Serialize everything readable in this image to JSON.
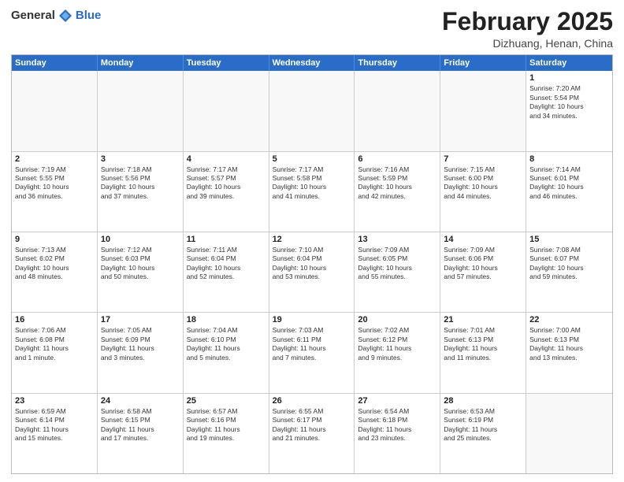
{
  "header": {
    "logo_general": "General",
    "logo_blue": "Blue",
    "month_title": "February 2025",
    "location": "Dizhuang, Henan, China"
  },
  "weekdays": [
    "Sunday",
    "Monday",
    "Tuesday",
    "Wednesday",
    "Thursday",
    "Friday",
    "Saturday"
  ],
  "rows": [
    [
      {
        "day": "",
        "info": ""
      },
      {
        "day": "",
        "info": ""
      },
      {
        "day": "",
        "info": ""
      },
      {
        "day": "",
        "info": ""
      },
      {
        "day": "",
        "info": ""
      },
      {
        "day": "",
        "info": ""
      },
      {
        "day": "1",
        "info": "Sunrise: 7:20 AM\nSunset: 5:54 PM\nDaylight: 10 hours\nand 34 minutes."
      }
    ],
    [
      {
        "day": "2",
        "info": "Sunrise: 7:19 AM\nSunset: 5:55 PM\nDaylight: 10 hours\nand 36 minutes."
      },
      {
        "day": "3",
        "info": "Sunrise: 7:18 AM\nSunset: 5:56 PM\nDaylight: 10 hours\nand 37 minutes."
      },
      {
        "day": "4",
        "info": "Sunrise: 7:17 AM\nSunset: 5:57 PM\nDaylight: 10 hours\nand 39 minutes."
      },
      {
        "day": "5",
        "info": "Sunrise: 7:17 AM\nSunset: 5:58 PM\nDaylight: 10 hours\nand 41 minutes."
      },
      {
        "day": "6",
        "info": "Sunrise: 7:16 AM\nSunset: 5:59 PM\nDaylight: 10 hours\nand 42 minutes."
      },
      {
        "day": "7",
        "info": "Sunrise: 7:15 AM\nSunset: 6:00 PM\nDaylight: 10 hours\nand 44 minutes."
      },
      {
        "day": "8",
        "info": "Sunrise: 7:14 AM\nSunset: 6:01 PM\nDaylight: 10 hours\nand 46 minutes."
      }
    ],
    [
      {
        "day": "9",
        "info": "Sunrise: 7:13 AM\nSunset: 6:02 PM\nDaylight: 10 hours\nand 48 minutes."
      },
      {
        "day": "10",
        "info": "Sunrise: 7:12 AM\nSunset: 6:03 PM\nDaylight: 10 hours\nand 50 minutes."
      },
      {
        "day": "11",
        "info": "Sunrise: 7:11 AM\nSunset: 6:04 PM\nDaylight: 10 hours\nand 52 minutes."
      },
      {
        "day": "12",
        "info": "Sunrise: 7:10 AM\nSunset: 6:04 PM\nDaylight: 10 hours\nand 53 minutes."
      },
      {
        "day": "13",
        "info": "Sunrise: 7:09 AM\nSunset: 6:05 PM\nDaylight: 10 hours\nand 55 minutes."
      },
      {
        "day": "14",
        "info": "Sunrise: 7:09 AM\nSunset: 6:06 PM\nDaylight: 10 hours\nand 57 minutes."
      },
      {
        "day": "15",
        "info": "Sunrise: 7:08 AM\nSunset: 6:07 PM\nDaylight: 10 hours\nand 59 minutes."
      }
    ],
    [
      {
        "day": "16",
        "info": "Sunrise: 7:06 AM\nSunset: 6:08 PM\nDaylight: 11 hours\nand 1 minute."
      },
      {
        "day": "17",
        "info": "Sunrise: 7:05 AM\nSunset: 6:09 PM\nDaylight: 11 hours\nand 3 minutes."
      },
      {
        "day": "18",
        "info": "Sunrise: 7:04 AM\nSunset: 6:10 PM\nDaylight: 11 hours\nand 5 minutes."
      },
      {
        "day": "19",
        "info": "Sunrise: 7:03 AM\nSunset: 6:11 PM\nDaylight: 11 hours\nand 7 minutes."
      },
      {
        "day": "20",
        "info": "Sunrise: 7:02 AM\nSunset: 6:12 PM\nDaylight: 11 hours\nand 9 minutes."
      },
      {
        "day": "21",
        "info": "Sunrise: 7:01 AM\nSunset: 6:13 PM\nDaylight: 11 hours\nand 11 minutes."
      },
      {
        "day": "22",
        "info": "Sunrise: 7:00 AM\nSunset: 6:13 PM\nDaylight: 11 hours\nand 13 minutes."
      }
    ],
    [
      {
        "day": "23",
        "info": "Sunrise: 6:59 AM\nSunset: 6:14 PM\nDaylight: 11 hours\nand 15 minutes."
      },
      {
        "day": "24",
        "info": "Sunrise: 6:58 AM\nSunset: 6:15 PM\nDaylight: 11 hours\nand 17 minutes."
      },
      {
        "day": "25",
        "info": "Sunrise: 6:57 AM\nSunset: 6:16 PM\nDaylight: 11 hours\nand 19 minutes."
      },
      {
        "day": "26",
        "info": "Sunrise: 6:55 AM\nSunset: 6:17 PM\nDaylight: 11 hours\nand 21 minutes."
      },
      {
        "day": "27",
        "info": "Sunrise: 6:54 AM\nSunset: 6:18 PM\nDaylight: 11 hours\nand 23 minutes."
      },
      {
        "day": "28",
        "info": "Sunrise: 6:53 AM\nSunset: 6:19 PM\nDaylight: 11 hours\nand 25 minutes."
      },
      {
        "day": "",
        "info": ""
      }
    ]
  ]
}
